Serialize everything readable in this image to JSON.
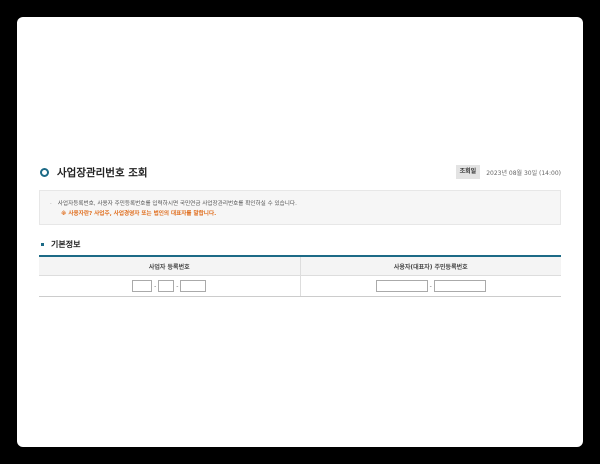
{
  "page": {
    "title": "사업장관리번호 조회",
    "date_label": "조회일",
    "date_value": "2023년 08월 30일 (14:00)"
  },
  "notice": {
    "line1": "사업자등록번호, 사용자 주민등록번호를 입력하시면 국민연금 사업장관리번호를 확인하실 수 있습니다.",
    "line2": "※ 사용자란? 사업주, 사업경영자 또는 법인의 대표자를 말합니다."
  },
  "section": {
    "title": "기본정보"
  },
  "table": {
    "headers": [
      "사업자 등록번호",
      "사용자(대표자) 주민등록번호"
    ],
    "separator": "-"
  }
}
